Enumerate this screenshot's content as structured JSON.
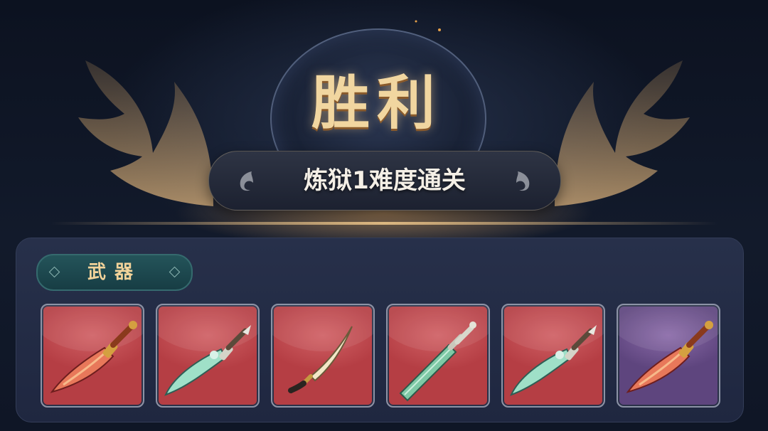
{
  "result": {
    "title": "胜利",
    "subtitle": "炼狱1难度通关"
  },
  "rewards": {
    "category_label": "武器",
    "items": [
      {
        "icon": "crimson-broadsword-icon",
        "rarity_color": "#b53e44"
      },
      {
        "icon": "jade-curved-sabre-icon",
        "rarity_color": "#b53e44"
      },
      {
        "icon": "curved-dagger-icon",
        "rarity_color": "#b53e44"
      },
      {
        "icon": "jade-straight-sword-icon",
        "rarity_color": "#b53e44"
      },
      {
        "icon": "jade-curved-sabre-icon",
        "rarity_color": "#b53e44"
      },
      {
        "icon": "crimson-broadsword-icon",
        "rarity_color": "#5e457e"
      }
    ]
  },
  "colors": {
    "gold": "#f1d6a0",
    "red_slot": "#b53e44",
    "purple_slot": "#5e457e",
    "panel": "#232c45"
  }
}
